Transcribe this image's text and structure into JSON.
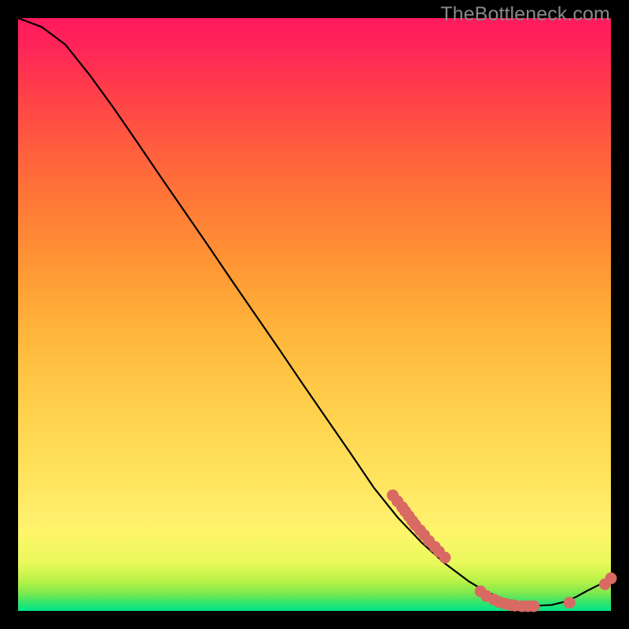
{
  "watermark": "TheBottleneck.com",
  "chart_data": {
    "type": "line",
    "x": [
      0.0,
      0.04,
      0.08,
      0.12,
      0.16,
      0.2,
      0.24,
      0.28,
      0.32,
      0.36,
      0.4,
      0.44,
      0.48,
      0.52,
      0.56,
      0.6,
      0.64,
      0.68,
      0.72,
      0.76,
      0.78,
      0.8,
      0.82,
      0.84,
      0.86,
      0.88,
      0.9,
      0.92,
      0.94,
      0.96,
      0.98,
      1.0
    ],
    "values": [
      1.0,
      0.985,
      0.955,
      0.905,
      0.85,
      0.792,
      0.733,
      0.675,
      0.617,
      0.558,
      0.5,
      0.442,
      0.383,
      0.325,
      0.267,
      0.208,
      0.158,
      0.116,
      0.08,
      0.05,
      0.038,
      0.028,
      0.02,
      0.014,
      0.01,
      0.009,
      0.01,
      0.015,
      0.023,
      0.034,
      0.044,
      0.056
    ],
    "title": "",
    "xlabel": "",
    "ylabel": "",
    "xlim": [
      0,
      1
    ],
    "ylim": [
      0,
      1
    ],
    "markers": {
      "color": "#d86a63",
      "points_x": [
        0.632,
        0.64,
        0.648,
        0.653,
        0.659,
        0.665,
        0.67,
        0.678,
        0.685,
        0.693,
        0.703,
        0.71,
        0.72,
        0.78,
        0.79,
        0.803,
        0.812,
        0.822,
        0.832,
        0.838,
        0.85,
        0.86,
        0.87,
        0.93,
        0.99,
        1.0
      ],
      "points_y": [
        0.195,
        0.185,
        0.175,
        0.168,
        0.16,
        0.152,
        0.145,
        0.136,
        0.128,
        0.118,
        0.108,
        0.1,
        0.09,
        0.033,
        0.025,
        0.019,
        0.015,
        0.012,
        0.01,
        0.009,
        0.008,
        0.008,
        0.008,
        0.014,
        0.045,
        0.055
      ]
    }
  }
}
